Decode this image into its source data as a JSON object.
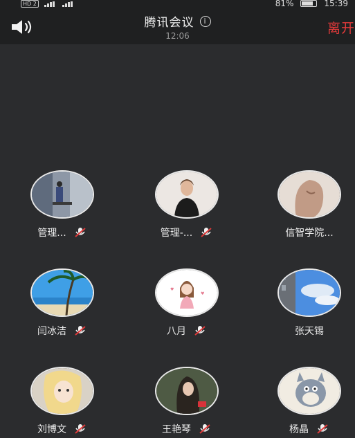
{
  "status_bar": {
    "hd_badge": "HD 2",
    "battery": "81%",
    "time": "15:39"
  },
  "header": {
    "title": "腾讯会议",
    "timer": "12:06",
    "leave_label": "离开",
    "speaker_icon": "speaker-icon",
    "info_icon": "info-icon"
  },
  "participants": [
    {
      "name": "管理...",
      "muted": true,
      "avatar": "gym-scene"
    },
    {
      "name": "管理-...",
      "muted": true,
      "avatar": "woman-portrait"
    },
    {
      "name": "信智学院...",
      "muted": false,
      "avatar": "statue-head"
    },
    {
      "name": "闫冰洁",
      "muted": true,
      "avatar": "palm-beach"
    },
    {
      "name": "八月",
      "muted": true,
      "avatar": "cartoon-girl"
    },
    {
      "name": "张天锡",
      "muted": false,
      "avatar": "sky-building"
    },
    {
      "name": "刘博文",
      "muted": true,
      "avatar": "anime-art"
    },
    {
      "name": "王艳琴",
      "muted": true,
      "avatar": "woman-outdoor"
    },
    {
      "name": "杨晶",
      "muted": true,
      "avatar": "cartoon-cat"
    }
  ],
  "colors": {
    "background": "#2b2c2e",
    "topbar": "#1f2021",
    "leave_red": "#e23a3a",
    "mute_red": "#e23a3a"
  }
}
